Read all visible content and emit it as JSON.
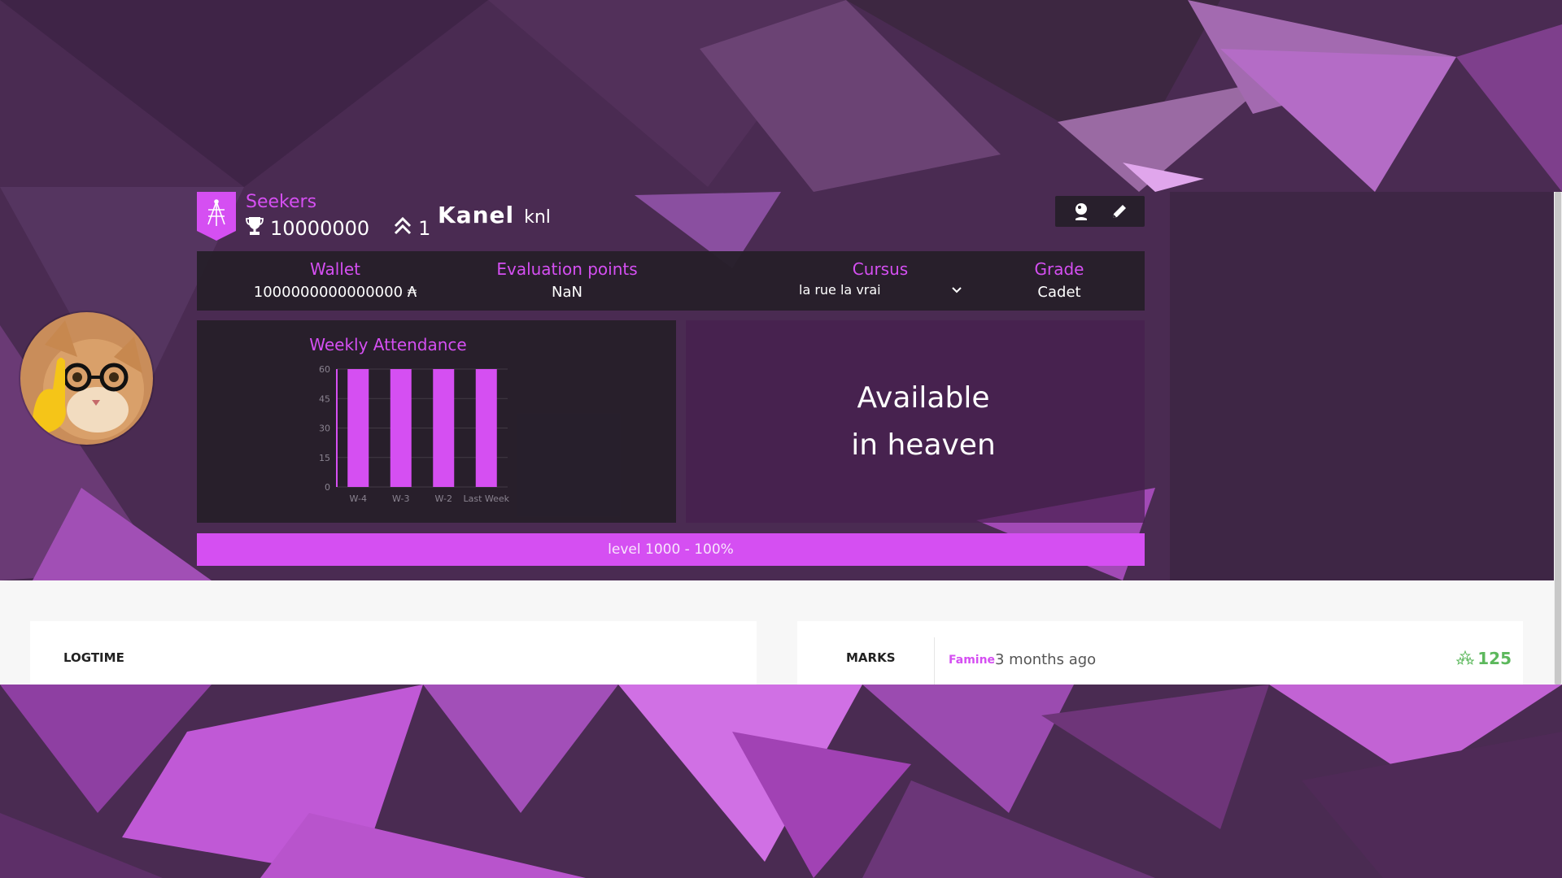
{
  "header": {
    "coalition_name": "Seekers",
    "trophy_score": "10000000",
    "rank": "1",
    "display_name": "Kanel",
    "login": "knl",
    "actions": [
      {
        "icon": "location-icon"
      },
      {
        "icon": "pencil-icon"
      }
    ]
  },
  "stats": {
    "wallet_label": "Wallet",
    "wallet_value": "1000000000000000 ₳",
    "eval_label": "Evaluation points",
    "eval_value": "NaN",
    "cursus_label": "Cursus",
    "cursus_value": "la rue la vrai",
    "grade_label": "Grade",
    "grade_value": "Cadet"
  },
  "attendance": {
    "title": "Weekly Attendance"
  },
  "chart_data": {
    "type": "bar",
    "title": "Weekly Attendance",
    "categories": [
      "W-4",
      "W-3",
      "W-2",
      "Last Week"
    ],
    "values": [
      60,
      60,
      60,
      60
    ],
    "ylim": [
      0,
      60
    ],
    "yticks": [
      "0",
      "15",
      "30",
      "45",
      "60"
    ],
    "grid": true,
    "color": "#d54ff2"
  },
  "heaven": {
    "text": "Available\nin heaven"
  },
  "level": {
    "text": "level 1000 - 100%",
    "progress": 1.0
  },
  "logtime": {
    "title": "LOGTIME"
  },
  "marks": {
    "title": "MARKS",
    "items": [
      {
        "project": "Famine",
        "date": "3 months ago",
        "score": "125"
      }
    ]
  },
  "colors": {
    "accent": "#d54ff2",
    "panel": "#261f2a",
    "success": "#5cb85c"
  }
}
